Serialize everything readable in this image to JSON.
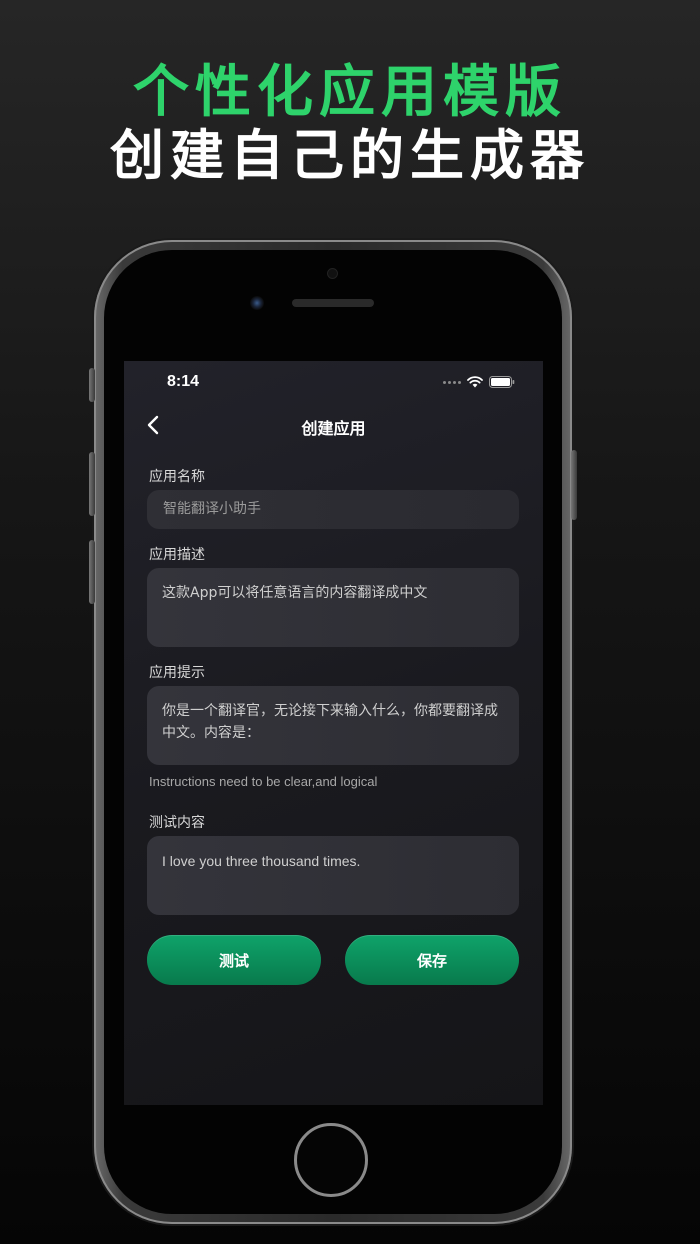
{
  "promo": {
    "headline": "个性化应用模版",
    "subheadline": "创建自己的生成器"
  },
  "status_bar": {
    "time": "8:14"
  },
  "nav": {
    "back_icon": "chevron-left-icon",
    "title": "创建应用"
  },
  "form": {
    "app_name": {
      "label": "应用名称",
      "placeholder": "智能翻译小助手"
    },
    "app_description": {
      "label": "应用描述",
      "value": "这款App可以将任意语言的内容翻译成中文"
    },
    "app_prompt": {
      "label": "应用提示",
      "value": "你是一个翻译官，无论接下来输入什么，你都要翻译成中文。内容是："
    },
    "hint": "Instructions need to be clear,and logical",
    "test_content": {
      "label": "测试内容",
      "value": "I love you three thousand times."
    }
  },
  "buttons": {
    "test_label": "测试",
    "save_label": "保存"
  },
  "colors": {
    "headline_green": "#2ed36b",
    "button_green": "#0b8f5a",
    "screen_bg": "#1c1c21",
    "field_bg": "#31313a"
  }
}
